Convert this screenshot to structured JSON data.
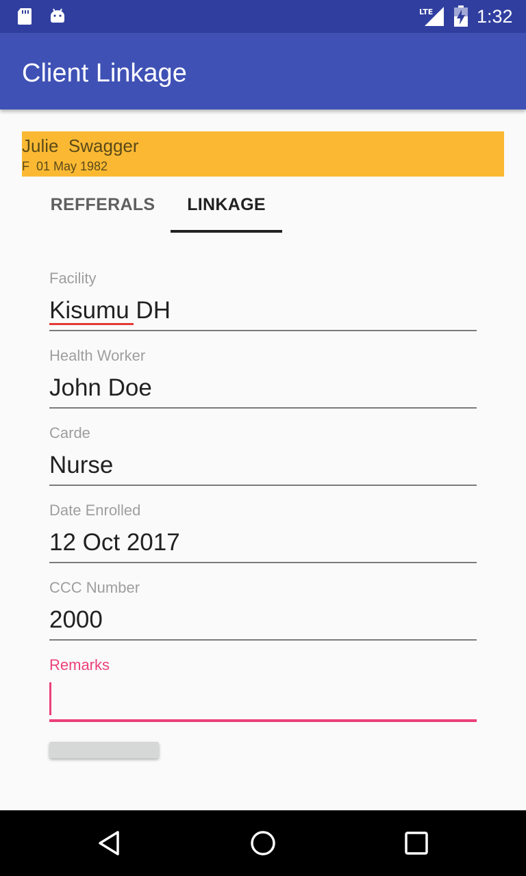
{
  "status_bar": {
    "time": "1:32",
    "icons": [
      "sd-card-icon",
      "android-icon",
      "lte-signal-icon",
      "battery-icon"
    ],
    "network_label": "LTE"
  },
  "app_bar": {
    "title": "Client Linkage"
  },
  "client": {
    "name": "Julie  Swagger",
    "meta": "F  01 May 1982"
  },
  "tabs": [
    {
      "label": "REFFERALS",
      "selected": false
    },
    {
      "label": "LINKAGE",
      "selected": true
    }
  ],
  "form": {
    "facility": {
      "label": "Facility",
      "value": "Kisumu DH"
    },
    "health_worker": {
      "label": "Health Worker",
      "value": "John Doe"
    },
    "carde": {
      "label": "Carde",
      "value": "Nurse"
    },
    "date_enrolled": {
      "label": "Date Enrolled",
      "value": "12 Oct 2017"
    },
    "ccc_number": {
      "label": "CCC Number",
      "value": "2000"
    },
    "remarks": {
      "label": "Remarks",
      "value": ""
    }
  },
  "nav_bar": {
    "icons": [
      "back-icon",
      "home-icon",
      "recents-icon"
    ]
  },
  "colors": {
    "status_bar": "#303f9f",
    "app_bar": "#3f51b5",
    "client_banner": "#fbb933",
    "accent": "#ec407a"
  }
}
